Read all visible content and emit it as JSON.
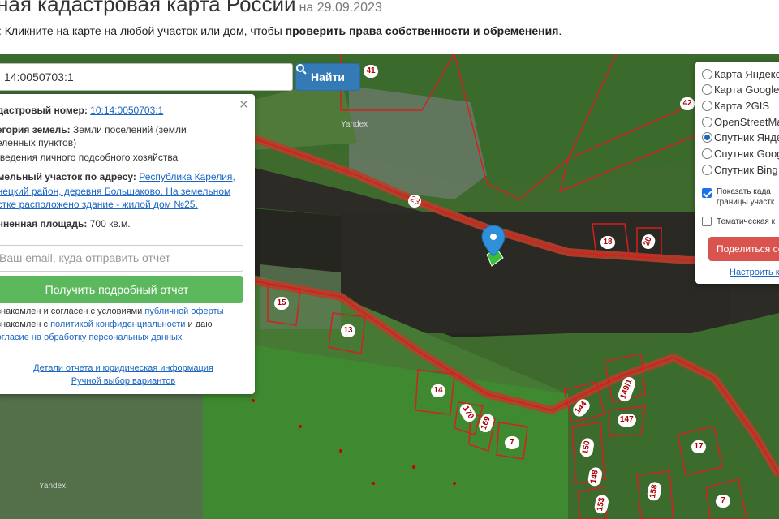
{
  "header": {
    "title": "ная кадастровая карта России",
    "date": "на 29.09.2023",
    "hint_prefix": ": Кликните на карте на любой участок или дом, чтобы ",
    "hint_bold": "проверить права собственности и обременения",
    "hint_suffix": "."
  },
  "search": {
    "value": "14:0050703:1",
    "button_label": "Найти"
  },
  "popup": {
    "cad_label": "адастровый номер:",
    "cad_value": "10:14:0050703:1",
    "category_label": "тегория земель:",
    "category_value_1": " Земли поселений (земли",
    "category_value_2": "селенных пунктов)",
    "purpose": "я ведения личного подсобного хозяйства",
    "address_label": "емельный участок по адресу:",
    "address_value_1": "Республика Карелия,",
    "address_value_2": "онецкий район, деревня Большаково. На земельном",
    "address_value_3": "астке расположено здание - жилой дом №25.",
    "area_label": "очненная площадь:",
    "area_value": " 700 кв.м.",
    "email_placeholder": "Ваш email, куда отправить отчет",
    "report_button": "Получить подробный отчет",
    "consent_1a": "ознакомлен и согласен с условиями ",
    "consent_1b": "публичной оферты",
    "consent_2a": "ознакомлен с ",
    "consent_2b": "политикой конфиденциальности",
    "consent_2c": " и даю",
    "consent_3": "согласие на обработку персональных данных",
    "details_link": "Детали отчета и юридическая информация",
    "manual_link": "Ручной выбор вариантов",
    "close": "×"
  },
  "layers": {
    "items": [
      {
        "label": "Карта Яндекс",
        "selected": false
      },
      {
        "label": "Карта Google",
        "selected": false
      },
      {
        "label": "Карта 2GIS",
        "selected": false
      },
      {
        "label": "OpenStreetMap",
        "selected": false
      },
      {
        "label": "Спутник Яндекс",
        "selected": true
      },
      {
        "label": "Спутник Google",
        "selected": false
      },
      {
        "label": "Спутник Bing",
        "selected": false
      }
    ],
    "show_borders_1": "Показать када",
    "show_borders_2": "границы участк",
    "thematic": "Тематическая к",
    "share": "Поделиться со",
    "configure": "Настроить к"
  },
  "map": {
    "watermark_1": "Yandex",
    "watermark_2": "Yandex",
    "road_label": "23",
    "parcel_labels": [
      "41",
      "42",
      "18",
      "20",
      "15",
      "13",
      "14",
      "170",
      "169",
      "7",
      "144",
      "149/1",
      "147",
      "150",
      "148",
      "153",
      "158",
      "17",
      "7"
    ],
    "colors": {
      "parcel": "#d42020",
      "water": "#2b2a24",
      "field": "#3d6b30",
      "accent": "#337ab7",
      "success": "#5cb85c",
      "danger": "#d9534f"
    }
  }
}
